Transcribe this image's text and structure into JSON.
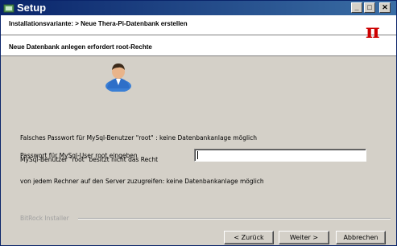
{
  "window": {
    "title": "Setup",
    "controls": {
      "minimize": "_",
      "maximize": "□",
      "close": "✕"
    }
  },
  "header": {
    "title": "Installationsvariante: > Neue Thera-Pi-Datenbank erstellen",
    "subtitle": "Neue Datenbank anlegen erfordert root-Rechte",
    "logo": "π",
    "logo_color": "#cc0000"
  },
  "icons": {
    "person": "user-icon",
    "app": "setup-icon"
  },
  "message": {
    "lines": [
      "Falsches Passwort für MySql-Benutzer \"root\" : keine Datenbankanlage möglich",
      "MySql-Benutzer \"root\" besitzt nicht das Recht",
      "von jedem Rechner auf den Server zuzugreifen: keine Datenbankanlage möglich"
    ]
  },
  "password": {
    "label": "Passwort für MySql-User root eingeben",
    "value": ""
  },
  "footer": {
    "brand": "BitRock Installer",
    "back_label": "< Zurück",
    "next_label": "Weiter >",
    "cancel_label": "Abbrechen"
  }
}
